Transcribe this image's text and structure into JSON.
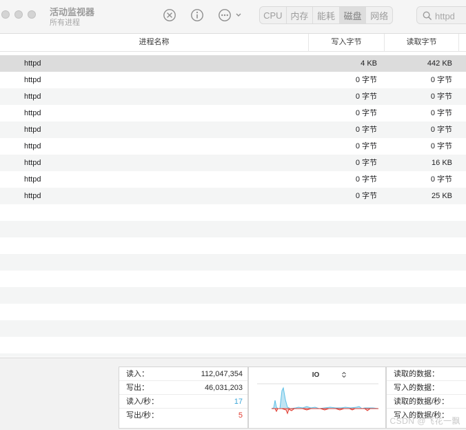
{
  "window": {
    "title": "活动监视器",
    "subtitle": "所有进程"
  },
  "toolbar": {
    "icons": [
      "stop-process-icon",
      "info-icon",
      "more-actions-icon"
    ],
    "tabs": [
      {
        "label": "CPU",
        "active": false
      },
      {
        "label": "内存",
        "active": false
      },
      {
        "label": "能耗",
        "active": false
      },
      {
        "label": "磁盘",
        "active": true
      },
      {
        "label": "网络",
        "active": false
      }
    ],
    "search": {
      "value": "httpd"
    }
  },
  "table": {
    "columns": [
      "进程名称",
      "写入字节",
      "读取字节"
    ],
    "rows": [
      {
        "name": "httpd",
        "written": "4 KB",
        "read": "442 KB",
        "selected": true
      },
      {
        "name": "httpd",
        "written": "0 字节",
        "read": "0 字节"
      },
      {
        "name": "httpd",
        "written": "0 字节",
        "read": "0 字节"
      },
      {
        "name": "httpd",
        "written": "0 字节",
        "read": "0 字节"
      },
      {
        "name": "httpd",
        "written": "0 字节",
        "read": "0 字节"
      },
      {
        "name": "httpd",
        "written": "0 字节",
        "read": "0 字节"
      },
      {
        "name": "httpd",
        "written": "0 字节",
        "read": "16 KB"
      },
      {
        "name": "httpd",
        "written": "0 字节",
        "read": "0 字节"
      },
      {
        "name": "httpd",
        "written": "0 字节",
        "read": "25 KB"
      }
    ]
  },
  "stats": {
    "left": [
      {
        "label": "读入：",
        "value": "112,047,354",
        "tone": "normal"
      },
      {
        "label": "写出：",
        "value": "46,031,203",
        "tone": "normal"
      },
      {
        "label": "读入/秒：",
        "value": "17",
        "tone": "blue"
      },
      {
        "label": "写出/秒：",
        "value": "5",
        "tone": "red"
      }
    ],
    "chart": {
      "title": "IO",
      "colors": {
        "read": "#5bbfe6",
        "write": "#e03a2f"
      }
    },
    "right": [
      {
        "label": "读取的数据："
      },
      {
        "label": "写入的数据："
      },
      {
        "label": "读取的数据/秒："
      },
      {
        "label": "写入的数据/秒："
      }
    ]
  },
  "watermark": "CSDN @飞花一飘"
}
